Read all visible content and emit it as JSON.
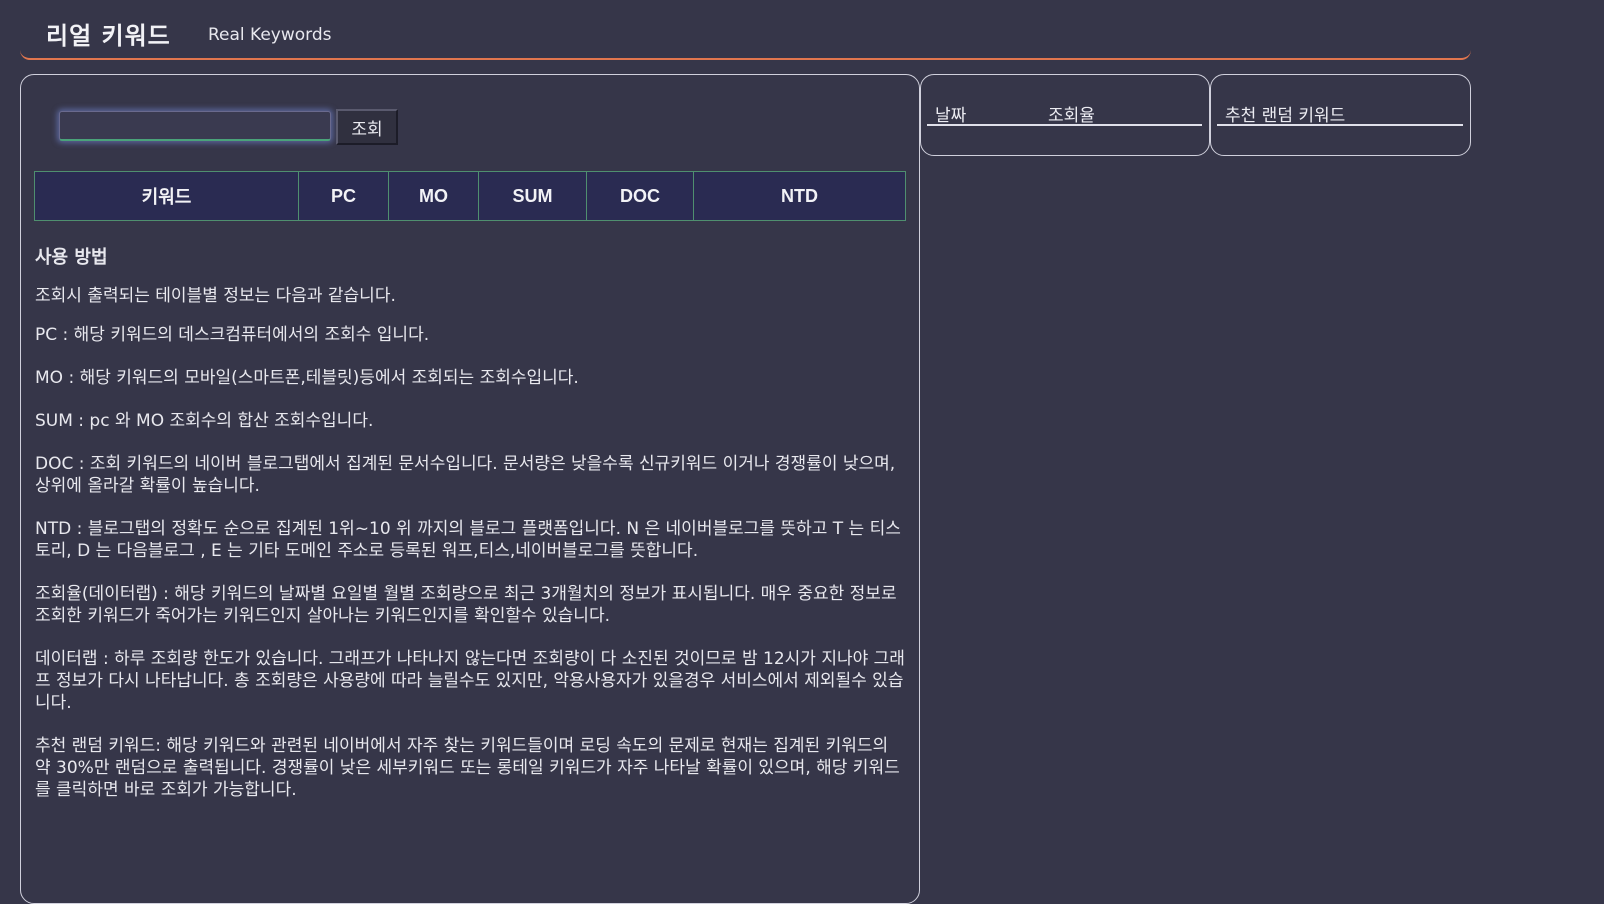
{
  "header": {
    "title": "리얼 키워드",
    "subtitle": "Real Keywords"
  },
  "search": {
    "value": "",
    "placeholder": "",
    "button_label": "조회"
  },
  "table": {
    "columns": [
      "키워드",
      "PC",
      "MO",
      "SUM",
      "DOC",
      "NTD"
    ]
  },
  "howto": {
    "title": "사용 방법",
    "intro": "조회시 출력되는 테이블별 정보는 다음과 같습니다.",
    "paragraphs": [
      "PC : 해당 키워드의 데스크컴퓨터에서의 조회수 입니다.",
      "MO : 해당 키워드의 모바일(스마트폰,테블릿)등에서 조회되는 조회수입니다.",
      "SUM : pc 와 MO 조회수의 합산 조회수입니다.",
      "DOC : 조회 키워드의 네이버 블로그탭에서 집계된 문서수입니다. 문서량은 낮을수록 신규키워드 이거나 경쟁률이 낮으며, 상위에 올라갈 확률이 높습니다.",
      "NTD : 블로그탭의 정확도 순으로 집계된 1위~10 위 까지의 블로그 플랫폼입니다. N 은 네이버블로그를 뜻하고 T 는 티스토리, D 는 다음블로그 , E 는 기타 도메인 주소로 등록된 워프,티스,네이버블로그를 뜻합니다.",
      "조회율(데이터랩) : 해당 키워드의 날짜별 요일별 월별 조회량으로 최근 3개월치의 정보가 표시됩니다. 매우 중요한 정보로 조회한 키워드가 죽어가는 키워드인지 살아나는 키워드인지를 확인할수 있습니다.",
      "데이터랩 : 하루 조회량 한도가 있습니다. 그래프가 나타나지 않는다면 조회량이 다 소진된 것이므로 밤 12시가 지나야 그래프 정보가 다시 나타납니다. 총 조회량은 사용량에 따라 늘릴수도 있지만, 악용사용자가 있을경우 서비스에서 제외될수 있습니다.",
      "추천 랜덤 키워드: 해당 키워드와 관련된 네이버에서 자주 찾는 키워드들이며 로딩 속도의 문제로 현재는 집계된 키워드의 약 30%만 랜덤으로 출력됩니다. 경쟁률이 낮은 세부키워드 또는 롱테일 키워드가 자주 나타날 확률이 있으며, 해당 키워드를 클릭하면 바로 조회가 가능합니다."
    ]
  },
  "stats_panel": {
    "date_label": "날짜",
    "rate_label": "조회율"
  },
  "random_panel": {
    "title": "추천 랜덤 키워드"
  }
}
